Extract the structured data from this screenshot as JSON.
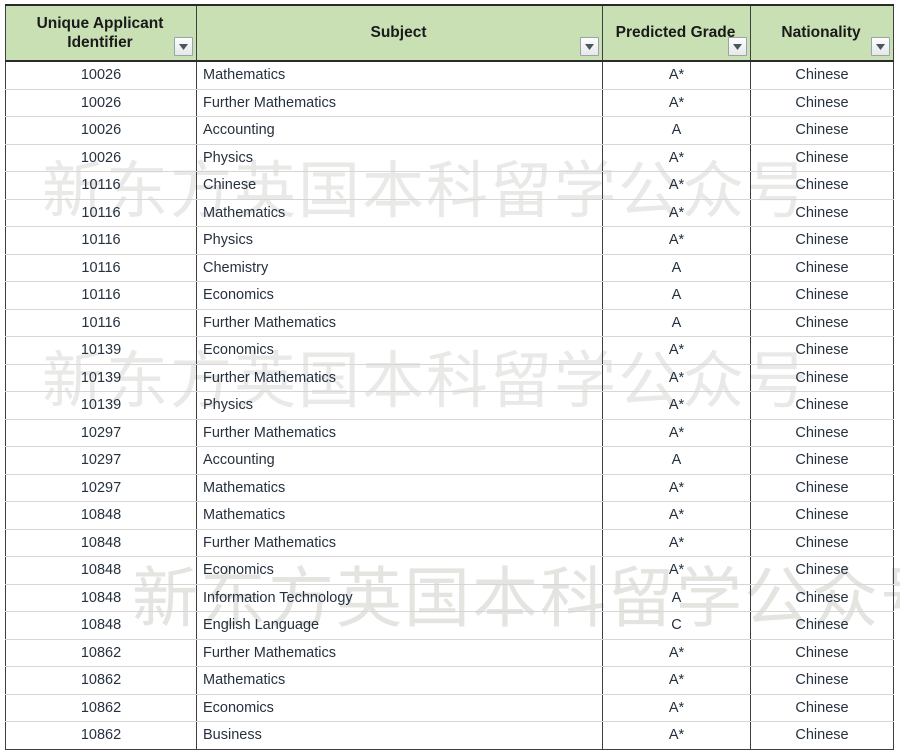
{
  "watermark": {
    "text": "新东方英国本科留学公众号",
    "color": "#e9e9e7",
    "repeats": 3
  },
  "table": {
    "header_background": "#c8e0b4",
    "grid_line_color": "#d6d6d6",
    "border_color": "#3f3f3f",
    "filter_icon": "filter-dropdown-arrow",
    "columns": [
      {
        "key": "id",
        "label": "Unique Applicant Identifier",
        "align": "center"
      },
      {
        "key": "subject",
        "label": "Subject",
        "align": "left"
      },
      {
        "key": "grade",
        "label": "Predicted Grade",
        "align": "center"
      },
      {
        "key": "nationality",
        "label": "Nationality",
        "align": "center"
      }
    ],
    "rows": [
      {
        "id": "10026",
        "subject": "Mathematics",
        "grade": "A*",
        "nationality": "Chinese"
      },
      {
        "id": "10026",
        "subject": "Further Mathematics",
        "grade": "A*",
        "nationality": "Chinese"
      },
      {
        "id": "10026",
        "subject": "Accounting",
        "grade": "A",
        "nationality": "Chinese"
      },
      {
        "id": "10026",
        "subject": "Physics",
        "grade": "A*",
        "nationality": "Chinese"
      },
      {
        "id": "10116",
        "subject": "Chinese",
        "grade": "A*",
        "nationality": "Chinese"
      },
      {
        "id": "10116",
        "subject": "Mathematics",
        "grade": "A*",
        "nationality": "Chinese"
      },
      {
        "id": "10116",
        "subject": "Physics",
        "grade": "A*",
        "nationality": "Chinese"
      },
      {
        "id": "10116",
        "subject": "Chemistry",
        "grade": "A",
        "nationality": "Chinese"
      },
      {
        "id": "10116",
        "subject": "Economics",
        "grade": "A",
        "nationality": "Chinese"
      },
      {
        "id": "10116",
        "subject": "Further Mathematics",
        "grade": "A",
        "nationality": "Chinese"
      },
      {
        "id": "10139",
        "subject": "Economics",
        "grade": "A*",
        "nationality": "Chinese"
      },
      {
        "id": "10139",
        "subject": "Further Mathematics",
        "grade": "A*",
        "nationality": "Chinese"
      },
      {
        "id": "10139",
        "subject": "Physics",
        "grade": "A*",
        "nationality": "Chinese"
      },
      {
        "id": "10297",
        "subject": "Further Mathematics",
        "grade": "A*",
        "nationality": "Chinese"
      },
      {
        "id": "10297",
        "subject": "Accounting",
        "grade": "A",
        "nationality": "Chinese"
      },
      {
        "id": "10297",
        "subject": "Mathematics",
        "grade": "A*",
        "nationality": "Chinese"
      },
      {
        "id": "10848",
        "subject": "Mathematics",
        "grade": "A*",
        "nationality": "Chinese"
      },
      {
        "id": "10848",
        "subject": "Further Mathematics",
        "grade": "A*",
        "nationality": "Chinese"
      },
      {
        "id": "10848",
        "subject": "Economics",
        "grade": "A*",
        "nationality": "Chinese"
      },
      {
        "id": "10848",
        "subject": "Information Technology",
        "grade": "A",
        "nationality": "Chinese"
      },
      {
        "id": "10848",
        "subject": "English Language",
        "grade": "C",
        "nationality": "Chinese"
      },
      {
        "id": "10862",
        "subject": "Further Mathematics",
        "grade": "A*",
        "nationality": "Chinese"
      },
      {
        "id": "10862",
        "subject": "Mathematics",
        "grade": "A*",
        "nationality": "Chinese"
      },
      {
        "id": "10862",
        "subject": "Economics",
        "grade": "A*",
        "nationality": "Chinese"
      },
      {
        "id": "10862",
        "subject": "Business",
        "grade": "A*",
        "nationality": "Chinese"
      }
    ]
  }
}
